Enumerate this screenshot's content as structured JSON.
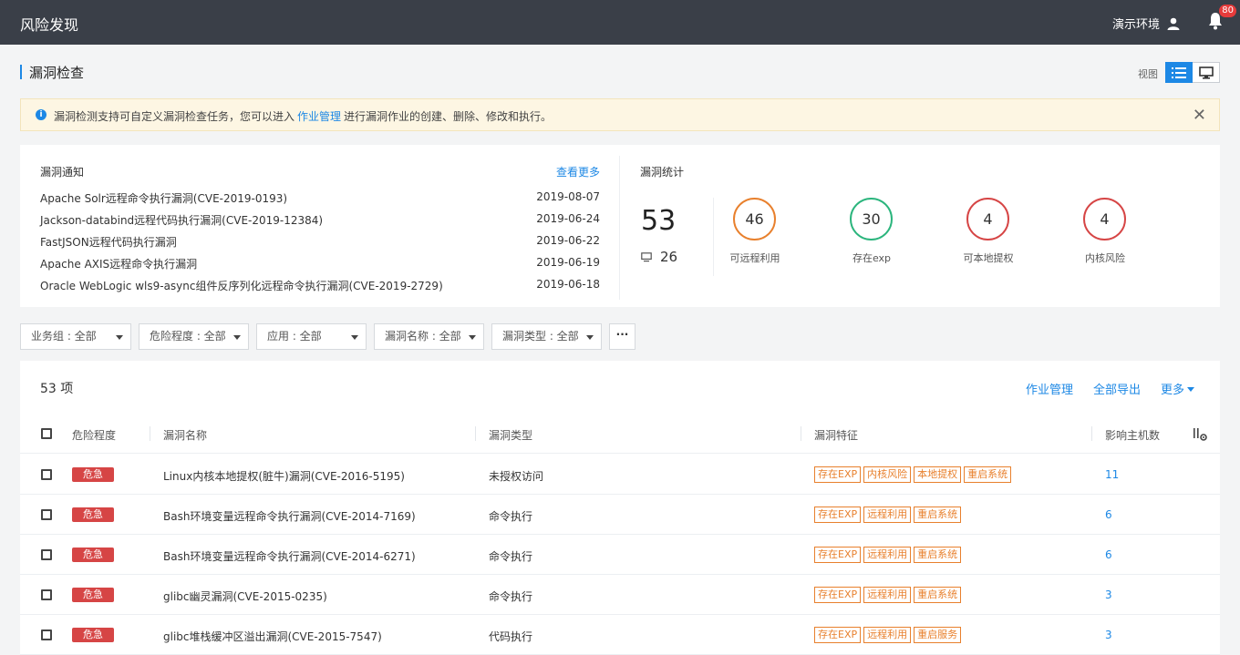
{
  "header": {
    "title": "风险发现",
    "env_label": "演示环境",
    "notification_count": "80"
  },
  "page": {
    "title": "漏洞检查",
    "view_label": "视图"
  },
  "notice": {
    "text_before": "漏洞检测支持可自定义漏洞检查任务，您可以进入",
    "link": "作业管理",
    "text_after": "进行漏洞作业的创建、删除、修改和执行。"
  },
  "news": {
    "title": "漏洞通知",
    "more": "查看更多",
    "items": [
      {
        "title": "Apache Solr远程命令执行漏洞(CVE-2019-0193)",
        "date": "2019-08-07"
      },
      {
        "title": "Jackson-databind远程代码执行漏洞(CVE-2019-12384)",
        "date": "2019-06-24"
      },
      {
        "title": "FastJSON远程代码执行漏洞",
        "date": "2019-06-22"
      },
      {
        "title": "Apache AXIS远程命令执行漏洞",
        "date": "2019-06-19"
      },
      {
        "title": "Oracle WebLogic wls9-async组件反序列化远程命令执行漏洞(CVE-2019-2729)",
        "date": "2019-06-18"
      }
    ]
  },
  "stats": {
    "title": "漏洞统计",
    "total": "53",
    "hosts": "26",
    "items": [
      {
        "value": "46",
        "label": "可远程利用",
        "color": "#e8802d"
      },
      {
        "value": "30",
        "label": "存在exp",
        "color": "#2bb57d"
      },
      {
        "value": "4",
        "label": "可本地提权",
        "color": "#d64545"
      },
      {
        "value": "4",
        "label": "内核风险",
        "color": "#d64545"
      }
    ]
  },
  "filters": [
    {
      "label": "业务组 : 全部"
    },
    {
      "label": "危险程度 : 全部"
    },
    {
      "label": "应用 : 全部"
    },
    {
      "label": "漏洞名称 : 全部"
    },
    {
      "label": "漏洞类型 : 全部"
    }
  ],
  "table": {
    "count_label": "53 项",
    "actions": {
      "manage": "作业管理",
      "export": "全部导出",
      "more": "更多"
    },
    "headers": {
      "severity": "危险程度",
      "name": "漏洞名称",
      "type": "漏洞类型",
      "features": "漏洞特征",
      "hosts": "影响主机数"
    },
    "rows": [
      {
        "severity": "危急",
        "name": "Linux内核本地提权(脏牛)漏洞(CVE-2016-5195)",
        "type": "未授权访问",
        "tags": [
          "存在EXP",
          "内核风险",
          "本地提权",
          "重启系统"
        ],
        "hosts": "11"
      },
      {
        "severity": "危急",
        "name": "Bash环境变量远程命令执行漏洞(CVE-2014-7169)",
        "type": "命令执行",
        "tags": [
          "存在EXP",
          "远程利用",
          "重启系统"
        ],
        "hosts": "6"
      },
      {
        "severity": "危急",
        "name": "Bash环境变量远程命令执行漏洞(CVE-2014-6271)",
        "type": "命令执行",
        "tags": [
          "存在EXP",
          "远程利用",
          "重启系统"
        ],
        "hosts": "6"
      },
      {
        "severity": "危急",
        "name": "glibc幽灵漏洞(CVE-2015-0235)",
        "type": "命令执行",
        "tags": [
          "存在EXP",
          "远程利用",
          "重启系统"
        ],
        "hosts": "3"
      },
      {
        "severity": "危急",
        "name": "glibc堆栈缓冲区溢出漏洞(CVE-2015-7547)",
        "type": "代码执行",
        "tags": [
          "存在EXP",
          "远程利用",
          "重启服务"
        ],
        "hosts": "3"
      }
    ]
  }
}
